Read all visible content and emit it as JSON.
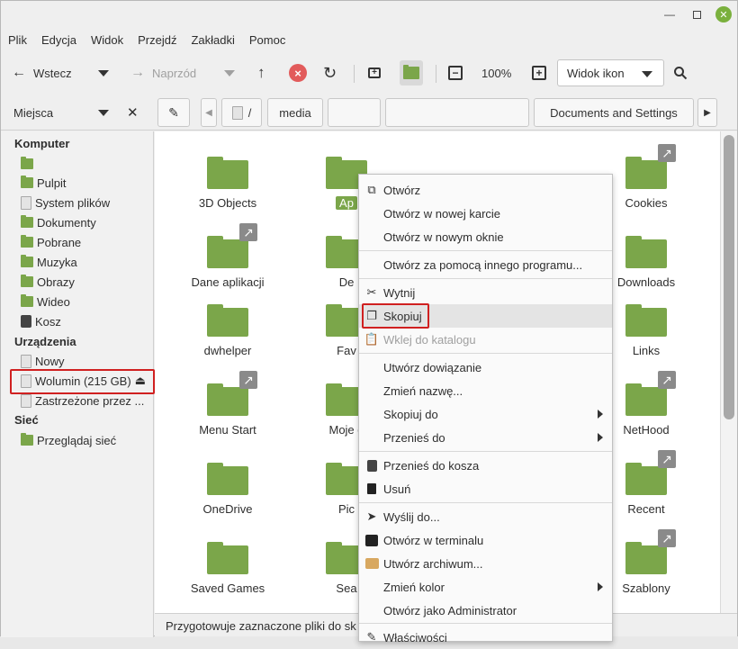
{
  "menubar": [
    "Plik",
    "Edycja",
    "Widok",
    "Przejdź",
    "Zakładki",
    "Pomoc"
  ],
  "toolbar": {
    "back": "Wstecz",
    "forward": "Naprzód",
    "zoom": "100%",
    "view_mode": "Widok ikon"
  },
  "sidebar": {
    "header": "Miejsca",
    "sections": {
      "computer": "Komputer",
      "devices": "Urządzenia",
      "network": "Sieć"
    },
    "computer_items": [
      "",
      "Pulpit",
      "System plików",
      "Dokumenty",
      "Pobrane",
      "Muzyka",
      "Obrazy",
      "Wideo",
      "Kosz"
    ],
    "device_items": [
      "Nowy",
      "Wolumin (215 GB)",
      "Zastrzeżone przez ..."
    ],
    "network_items": [
      "Przeglądaj sieć"
    ]
  },
  "pathbar": {
    "root": "/",
    "media": "media",
    "current": "Documents and Settings"
  },
  "folders": [
    {
      "name": "3D Objects",
      "link": false
    },
    {
      "name": "Ap",
      "link": false
    },
    {
      "name": "Cookies",
      "link": true
    },
    {
      "name": "Dane aplikacji",
      "link": true
    },
    {
      "name": "De",
      "link": false
    },
    {
      "name": "Downloads",
      "link": false
    },
    {
      "name": "dwhelper",
      "link": false
    },
    {
      "name": "Fav",
      "link": false
    },
    {
      "name": "Links",
      "link": false
    },
    {
      "name": "Menu Start",
      "link": true
    },
    {
      "name": "Moje d",
      "link": false
    },
    {
      "name": "NetHood",
      "link": true
    },
    {
      "name": "OneDrive",
      "link": false
    },
    {
      "name": "Pic",
      "link": false
    },
    {
      "name": "Recent",
      "link": true
    },
    {
      "name": "Saved Games",
      "link": false
    },
    {
      "name": "Sea",
      "link": false
    },
    {
      "name": "Szablony",
      "link": true
    }
  ],
  "status": "Przygotowuje zaznaczone pliki do sk",
  "context_menu": [
    {
      "label": "Otwórz",
      "icon": "open-icon"
    },
    {
      "label": "Otwórz w nowej karcie"
    },
    {
      "label": "Otwórz w nowym oknie"
    },
    {
      "label": "Otwórz za pomocą innego programu..."
    },
    {
      "label": "Wytnij",
      "icon": "cut-icon"
    },
    {
      "label": "Skopiuj",
      "icon": "copy-icon"
    },
    {
      "label": "Wklej do katalogu",
      "icon": "paste-icon",
      "disabled": true
    },
    {
      "label": "Utwórz dowiązanie"
    },
    {
      "label": "Zmień nazwę..."
    },
    {
      "label": "Skopiuj do",
      "submenu": true
    },
    {
      "label": "Przenieś do",
      "submenu": true
    },
    {
      "label": "Przenieś do kosza",
      "icon": "trash-icon"
    },
    {
      "label": "Usuń",
      "icon": "delete-icon"
    },
    {
      "label": "Wyślij do...",
      "icon": "send-icon"
    },
    {
      "label": "Otwórz w terminalu",
      "icon": "terminal-icon"
    },
    {
      "label": "Utwórz archiwum...",
      "icon": "archive-icon"
    },
    {
      "label": "Zmień kolor",
      "submenu": true
    },
    {
      "label": "Otwórz jako Administrator"
    },
    {
      "label": "Właściwości",
      "icon": "properties-icon"
    }
  ],
  "colors": {
    "accent": "#7ba64a",
    "highlight_box": "#d02020",
    "stop": "#e25b5b"
  }
}
